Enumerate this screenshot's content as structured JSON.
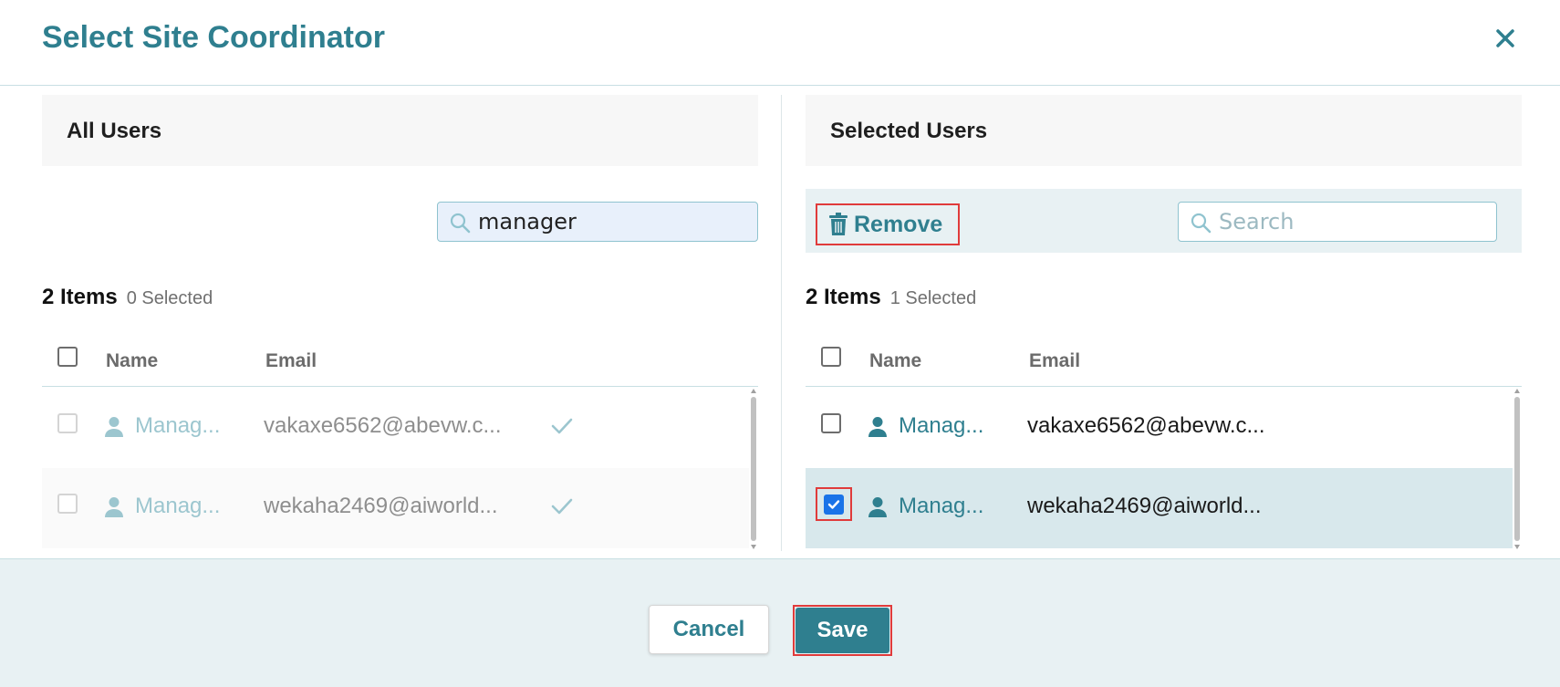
{
  "dialog": {
    "title": "Select Site Coordinator",
    "close_icon": "close-icon"
  },
  "all_users": {
    "heading": "All Users",
    "search": {
      "value": "manager",
      "placeholder": "Search",
      "icon": "search-icon"
    },
    "count_label": "2 Items",
    "selected_label": "0 Selected",
    "columns": {
      "name": "Name",
      "email": "Email"
    },
    "rows": [
      {
        "name": "Manag...",
        "email": "vakaxe6562@abevw.c...",
        "added": true,
        "icon": "user-icon"
      },
      {
        "name": "Manag...",
        "email": "wekaha2469@aiworld...",
        "added": true,
        "icon": "user-icon"
      }
    ]
  },
  "selected_users": {
    "heading": "Selected Users",
    "remove_label": "Remove",
    "remove_icon": "trash-icon",
    "search": {
      "value": "",
      "placeholder": "Search",
      "icon": "search-icon"
    },
    "count_label": "2 Items",
    "selected_label": "1 Selected",
    "columns": {
      "name": "Name",
      "email": "Email"
    },
    "rows": [
      {
        "name": "Manag...",
        "email": "vakaxe6562@abevw.c...",
        "checked": false,
        "icon": "user-icon"
      },
      {
        "name": "Manag...",
        "email": "wekaha2469@aiworld...",
        "checked": true,
        "icon": "user-icon"
      }
    ]
  },
  "footer": {
    "cancel_label": "Cancel",
    "save_label": "Save"
  },
  "colors": {
    "accent": "#2f7f8f",
    "highlight_border": "#e03b3b",
    "selected_row": "#d8e8ec",
    "footer_bg": "#e8f1f3"
  }
}
